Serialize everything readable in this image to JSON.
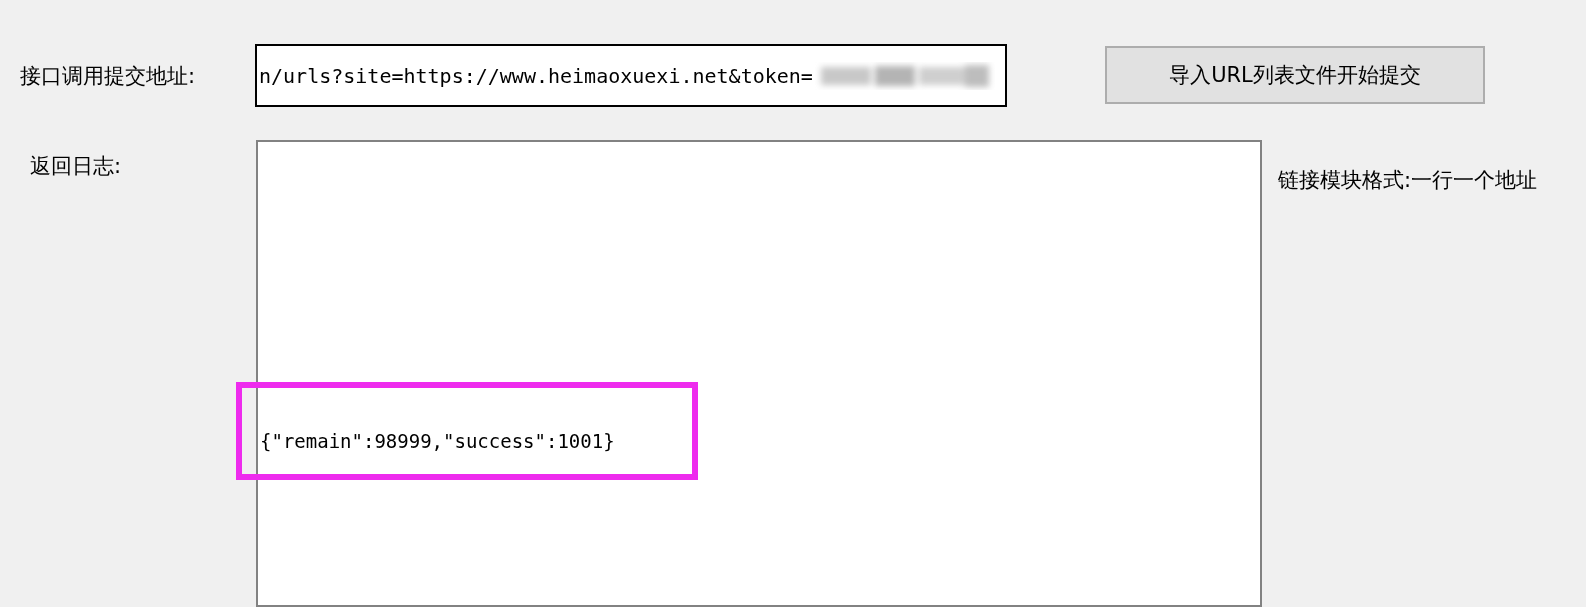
{
  "submit_url": {
    "label": "接口调用提交地址:",
    "value": "n/urls?site=https://www.heimaoxuexi.net&token="
  },
  "import_button": {
    "label": "导入URL列表文件开始提交"
  },
  "log": {
    "label": "返回日志:",
    "lines": [
      "{\"remain\":98999,\"success\":1001}"
    ],
    "highlighted": true
  },
  "format_hint": "链接模块格式:一行一个地址"
}
